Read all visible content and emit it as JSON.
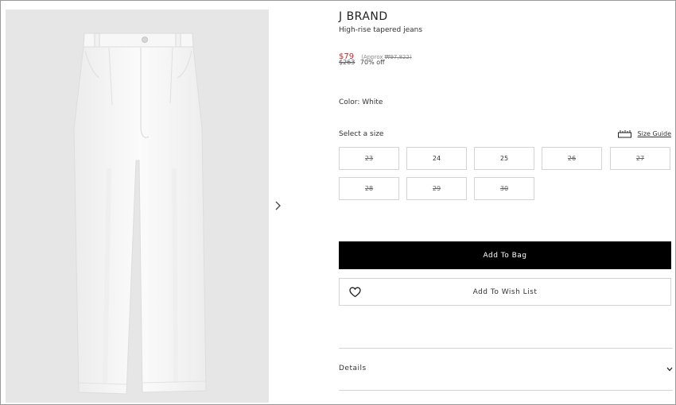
{
  "product": {
    "brand": "J BRAND",
    "name": "High-rise tapered jeans",
    "price": "$79",
    "approx_label": "(Approx",
    "approx_value": "₩97,822)",
    "original_price": "$263",
    "discount": "70% off",
    "color": "Color: White"
  },
  "sizes": {
    "label": "Select a size",
    "guide_label": "Size Guide",
    "options": [
      {
        "label": "23",
        "available": false
      },
      {
        "label": "24",
        "available": true
      },
      {
        "label": "25",
        "available": true
      },
      {
        "label": "26",
        "available": false
      },
      {
        "label": "27",
        "available": false
      },
      {
        "label": "28",
        "available": false
      },
      {
        "label": "29",
        "available": false
      },
      {
        "label": "30",
        "available": false
      }
    ]
  },
  "actions": {
    "add_to_bag": "Add To Bag",
    "add_to_wishlist": "Add To Wish List"
  },
  "accordion": {
    "details_label": "Details"
  },
  "colors": {
    "sale_price": "#c62828",
    "primary_button": "#000000",
    "image_background": "#e6e6e6"
  },
  "icons": {
    "next": "chevron-right-icon",
    "size_guide": "ruler-icon",
    "wishlist": "heart-icon",
    "details": "chevron-down-icon"
  }
}
